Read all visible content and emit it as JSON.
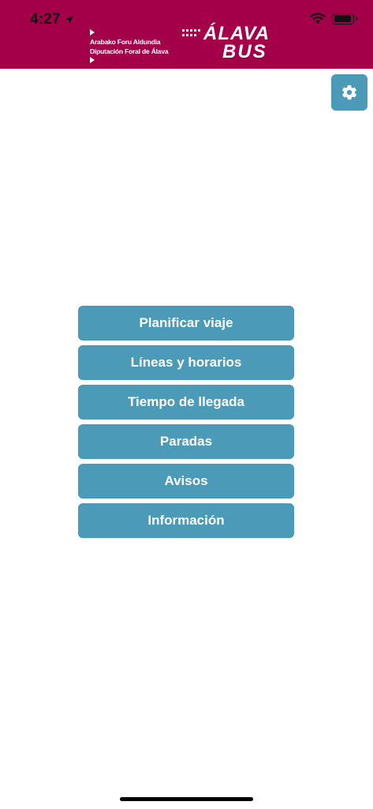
{
  "status_bar": {
    "time": "4:27",
    "icons": [
      "location-arrow-icon",
      "wifi-icon",
      "battery-icon"
    ]
  },
  "header": {
    "org_line1": "Arabako Foru Aldundia",
    "org_line2": "Diputación Foral de Álava",
    "logo_line1": "ÁLAVA",
    "logo_line2": "BUS",
    "background_color": "#a4004a"
  },
  "settings": {
    "icon": "gear-icon"
  },
  "menu": {
    "button_color": "#4a9ab8",
    "items": [
      {
        "label": "Planificar viaje"
      },
      {
        "label": "Líneas y horarios"
      },
      {
        "label": "Tiempo de llegada"
      },
      {
        "label": "Paradas"
      },
      {
        "label": "Avisos"
      },
      {
        "label": "Información"
      }
    ]
  }
}
